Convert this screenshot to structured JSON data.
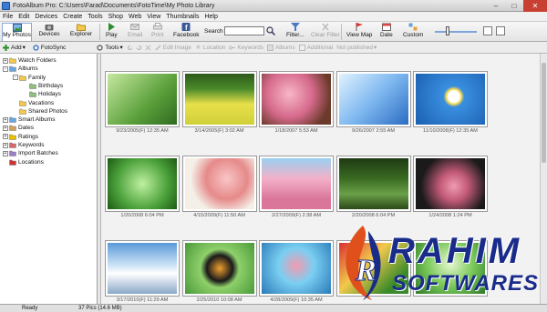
{
  "window": {
    "title": "FotoAlbum Pro: C:\\Users\\Farad\\Documents\\FotoTime\\My Photo Library"
  },
  "menu": [
    "File",
    "Edit",
    "Devices",
    "Create",
    "Tools",
    "Shop",
    "Web",
    "View",
    "Thumbnails",
    "Help"
  ],
  "tabs": {
    "my_photos": "My Photos",
    "devices": "Devices",
    "explorer": "Explorer"
  },
  "toolbar": {
    "play": "Play",
    "email": "Email",
    "print": "Print",
    "facebook": "Facebook",
    "search_label": "Search",
    "search_value": "",
    "filter": "Filter...",
    "clear_filter": "Clear Filter",
    "view_map": "View Map",
    "date": "Date",
    "custom": "Custom"
  },
  "subbar": {
    "add": "Add",
    "fotosync": "FotoSync",
    "tools": "Tools",
    "edit_image": "Edit Image",
    "location": "Location",
    "keywords": "Keywords",
    "albums": "Albums",
    "additional": "Additional",
    "not_published": "Not published"
  },
  "tree": [
    {
      "label": "Watch Folders",
      "expander": "+",
      "indent": 0
    },
    {
      "label": "Albums",
      "expander": "-",
      "indent": 0
    },
    {
      "label": "Family",
      "expander": "-",
      "indent": 1
    },
    {
      "label": "Birthdays",
      "expander": "",
      "indent": 2
    },
    {
      "label": "Holidays",
      "expander": "",
      "indent": 2
    },
    {
      "label": "Vacations",
      "expander": "",
      "indent": 1
    },
    {
      "label": "Shared Photos",
      "expander": "",
      "indent": 1
    },
    {
      "label": "Smart Albums",
      "expander": "+",
      "indent": 0
    },
    {
      "label": "Dates",
      "expander": "+",
      "indent": 0
    },
    {
      "label": "Ratings",
      "expander": "+",
      "indent": 0
    },
    {
      "label": "Keywords",
      "expander": "+",
      "indent": 0
    },
    {
      "label": "Import Batches",
      "expander": "+",
      "indent": 0
    },
    {
      "label": "Locations",
      "expander": "",
      "indent": 0
    }
  ],
  "photos": [
    {
      "caption": "9/23/2005(F) 12:35 AM",
      "subject": "bird on branch"
    },
    {
      "caption": "3/14/2005(F) 3:02 AM",
      "subject": "yellow field"
    },
    {
      "caption": "1/18/2007 5:53 AM",
      "subject": "pink blossoms"
    },
    {
      "caption": "9/26/2007 2:55 AM",
      "subject": "blue abstract"
    },
    {
      "caption": "11/10/2008(F) 12:35 AM",
      "subject": "daisy sky"
    },
    {
      "caption": "1/20/2008 6:04 PM",
      "subject": "green leaves"
    },
    {
      "caption": "4/15/2009(F) 11:50 AM",
      "subject": "pink roses"
    },
    {
      "caption": "2/27/2009(F) 2:38 AM",
      "subject": "cherry blossoms"
    },
    {
      "caption": "2/20/2008 6:04 PM",
      "subject": "tree tunnel"
    },
    {
      "caption": "1/24/2008 1:24 PM",
      "subject": "pink tulips"
    },
    {
      "caption": "3/17/2010(F) 11:29 AM",
      "subject": "snow mountain"
    },
    {
      "caption": "2/25/2010 10:08 AM",
      "subject": "butterfly"
    },
    {
      "caption": "4/28/2009(F) 10:35 AM",
      "subject": "rose in water"
    },
    {
      "caption": "",
      "subject": "red flowers"
    },
    {
      "caption": "",
      "subject": "green abstract"
    }
  ],
  "status": {
    "ready": "Ready",
    "count": "37 Pics (14.6 MB)"
  },
  "watermark": {
    "line1": "RAHIM",
    "line2": "SOFTWARES"
  },
  "colors": {
    "accent": "#3a7bd5",
    "brand": "#1a2c8a"
  }
}
